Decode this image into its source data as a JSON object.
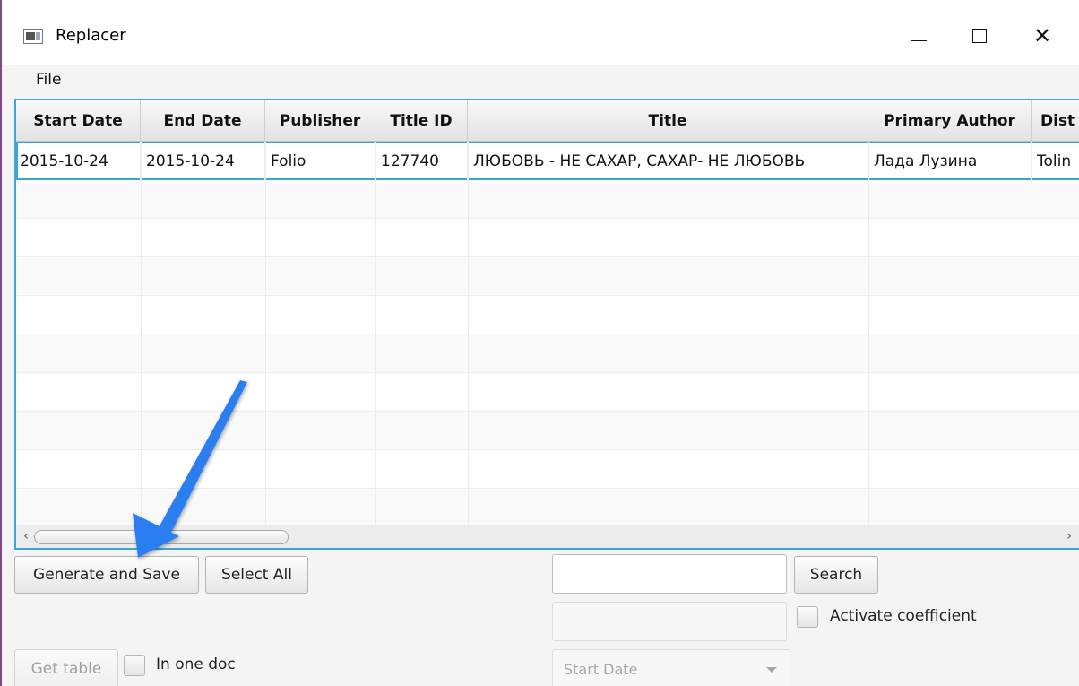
{
  "window": {
    "title": "Replacer",
    "minimize_icon": "minimize-icon",
    "maximize_icon": "maximize-icon",
    "close_icon": "close-icon",
    "close_glyph": "✕"
  },
  "menu": {
    "file_label": "File"
  },
  "table": {
    "columns": [
      "Start Date",
      "End Date",
      "Publisher",
      "Title ID",
      "Title",
      "Primary Author",
      "Dist"
    ],
    "rows": [
      [
        "2015-10-24",
        "2015-10-24",
        "Folio",
        "127740",
        "ЛЮБОВЬ - НЕ САХАР, САХАР- НЕ ЛЮБОВЬ",
        "Лада Лузина",
        "Tolin"
      ]
    ],
    "selected_row": 0,
    "accent_color": "#3aa6d1"
  },
  "scrollbar": {
    "left_glyph": "‹",
    "right_glyph": "›"
  },
  "controls": {
    "generate_save_label": "Generate and Save",
    "select_all_label": "Select All",
    "search_label": "Search",
    "search_value": "",
    "coefficient_value": "",
    "activate_coefficient_label": "Activate coefficient",
    "get_table_label": "Get table",
    "in_one_doc_label": "In one doc",
    "start_date_placeholder": "Start Date"
  },
  "annotation": {
    "arrow_color": "#2b7ef0",
    "arrow_icon": "pointer-arrow-icon"
  }
}
